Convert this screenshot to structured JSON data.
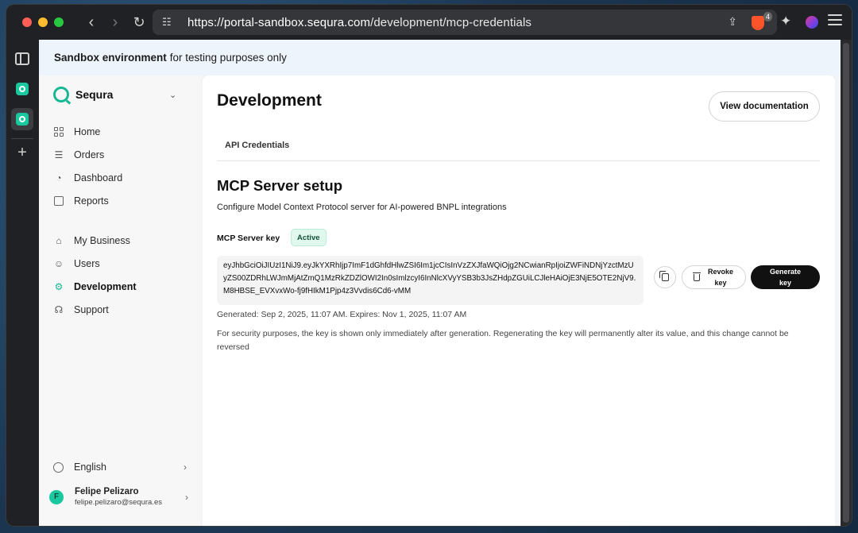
{
  "browser": {
    "url_host": "https://portal-sandbox.sequra.com",
    "url_path": "/development/mcp-credentials",
    "brave_badge": "4"
  },
  "banner": {
    "bold": "Sandbox environment",
    "rest": "for testing purposes only"
  },
  "sidebar": {
    "brand": "Sequra",
    "primary": [
      {
        "label": "Home",
        "icon": "home-grid-icon"
      },
      {
        "label": "Orders",
        "icon": "receipt-icon"
      },
      {
        "label": "Dashboard",
        "icon": "pie-chart-icon"
      },
      {
        "label": "Reports",
        "icon": "document-icon"
      }
    ],
    "secondary": [
      {
        "label": "My Business",
        "icon": "store-icon"
      },
      {
        "label": "Users",
        "icon": "user-icon"
      },
      {
        "label": "Development",
        "icon": "gear-icon",
        "active": true
      },
      {
        "label": "Support",
        "icon": "headset-icon"
      }
    ],
    "language": "English",
    "user": {
      "initial": "F",
      "name": "Felipe Pelizaro",
      "email": "felipe.pelizaro@sequra.es"
    }
  },
  "main": {
    "title": "Development",
    "doc_button": "View documentation",
    "tabs": [
      "API Credentials"
    ],
    "section_title": "MCP Server setup",
    "section_sub": "Configure Model Context Protocol server for AI-powered BNPL integrations",
    "key_label": "MCP Server key",
    "status": "Active",
    "key_value": "eyJhbGciOiJIUzI1NiJ9.eyJkYXRhIjp7ImF1dGhfdHlwZSI6Im1jcCIsInVzZXJfaWQiOjg2NCwianRpIjoiZWFiNDNjYzctMzUyZS00ZDRhLWJmMjAtZmQ1MzRkZDZlOWI2In0sImlzcyI6InNlcXVyYSB3b3JsZHdpZGUiLCJleHAiOjE3NjE5OTE2NjV9.M8HBSE_EVXvxWo-fj9fHIkM1Pjp4z3Vvdis6Cd6-vMM",
    "revoke_button": "Revoke key",
    "generate_button": "Generate key",
    "generated_info": "Generated: Sep 2, 2025, 11:07 AM. Expires: Nov 1, 2025, 11:07 AM",
    "security_note": "For security purposes, the key is shown only immediately after generation. Regenerating the key will permanently alter its value, and this change cannot be reversed"
  },
  "colors": {
    "accent": "#18b894",
    "active_badge_bg": "#e1f8ee",
    "primary_button": "#111111"
  }
}
